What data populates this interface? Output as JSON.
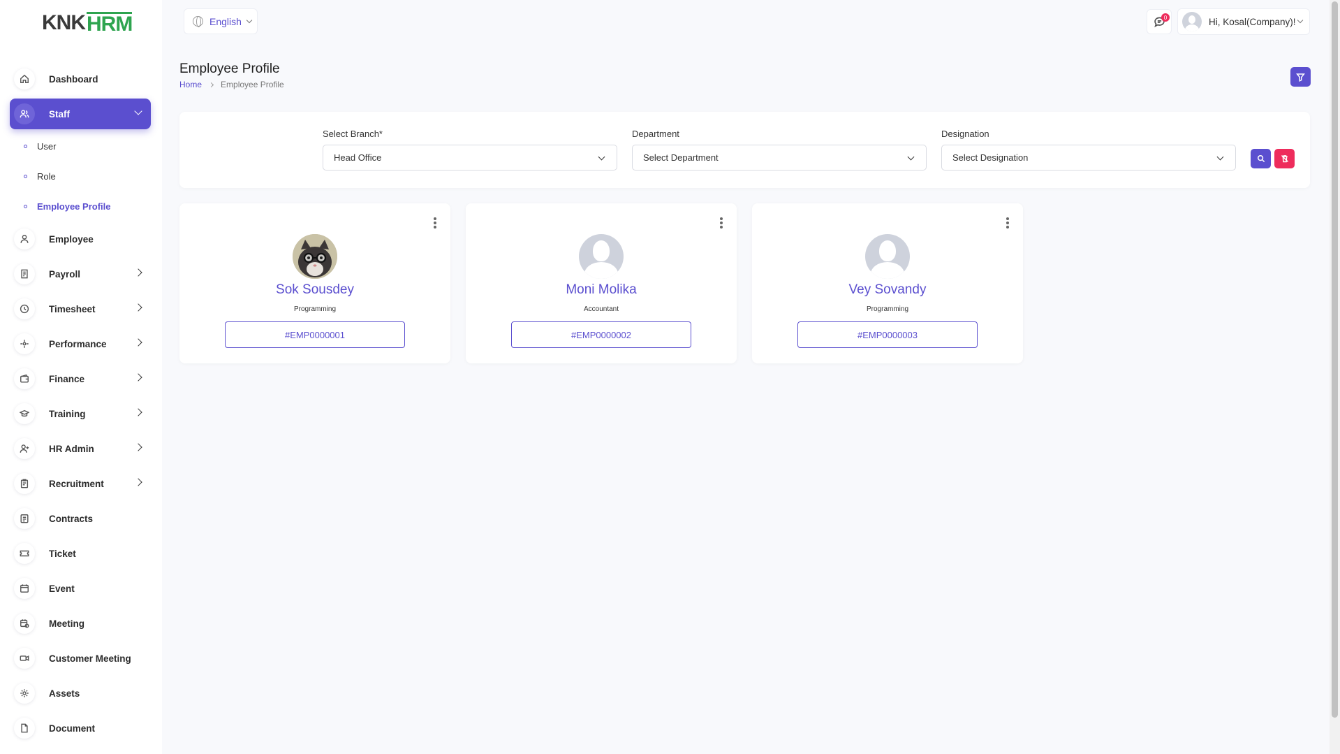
{
  "brand": {
    "left": "KNK",
    "right": "HRM"
  },
  "header": {
    "language": "English",
    "notification_count": "0",
    "user_greeting": "Hi, Kosal(Company)!"
  },
  "sidebar": {
    "items": [
      {
        "label": "Dashboard",
        "icon": "home-icon"
      },
      {
        "label": "Staff",
        "icon": "users-icon",
        "active": true
      },
      {
        "label": "Employee",
        "icon": "user-icon"
      },
      {
        "label": "Payroll",
        "icon": "receipt-icon"
      },
      {
        "label": "Timesheet",
        "icon": "clock-icon"
      },
      {
        "label": "Performance",
        "icon": "target-icon"
      },
      {
        "label": "Finance",
        "icon": "wallet-icon"
      },
      {
        "label": "Training",
        "icon": "graduation-cap-icon"
      },
      {
        "label": "HR Admin",
        "icon": "user-plus-icon"
      },
      {
        "label": "Recruitment",
        "icon": "clipboard-icon"
      },
      {
        "label": "Contracts",
        "icon": "contract-icon"
      },
      {
        "label": "Ticket",
        "icon": "ticket-icon"
      },
      {
        "label": "Event",
        "icon": "calendar-icon"
      },
      {
        "label": "Meeting",
        "icon": "calendar-clock-icon"
      },
      {
        "label": "Customer Meeting",
        "icon": "video-icon"
      },
      {
        "label": "Assets",
        "icon": "gear-icon"
      },
      {
        "label": "Document",
        "icon": "file-icon"
      }
    ],
    "staff_sub": [
      {
        "label": "User"
      },
      {
        "label": "Role"
      },
      {
        "label": "Employee Profile",
        "current": true
      }
    ]
  },
  "page": {
    "title": "Employee Profile",
    "breadcrumb": {
      "home": "Home",
      "current": "Employee Profile"
    }
  },
  "filters": {
    "branch": {
      "label": "Select Branch*",
      "value": "Head Office"
    },
    "department": {
      "label": "Department",
      "value": "Select Department"
    },
    "designation": {
      "label": "Designation",
      "value": "Select Designation"
    }
  },
  "employees": [
    {
      "name": "Sok Sousdey",
      "designation": "Programming",
      "id": "#EMP0000001",
      "photo": "cat-with-glasses"
    },
    {
      "name": "Moni Molika",
      "designation": "Accountant",
      "id": "#EMP0000002",
      "photo": "default-avatar"
    },
    {
      "name": "Vey Sovandy",
      "designation": "Programming",
      "id": "#EMP0000003",
      "photo": "default-avatar"
    }
  ],
  "colors": {
    "primary": "#5b4fcf",
    "danger": "#ee2c5c",
    "logo_green": "#2ea44f"
  }
}
